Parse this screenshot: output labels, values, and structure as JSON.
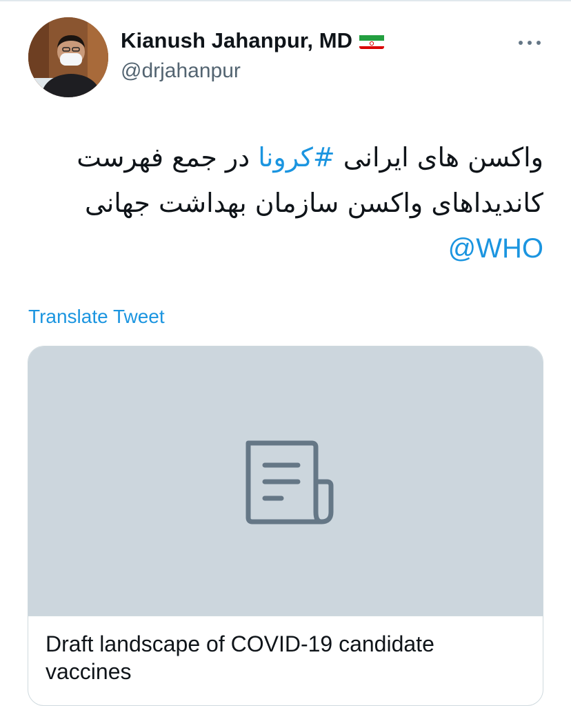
{
  "tweet": {
    "author": {
      "display_name": "Kianush Jahanpur, MD",
      "flag_icon": "iran-flag-icon",
      "handle": "@drjahanpur",
      "avatar_icon": "user-avatar"
    },
    "more_icon": "more-dots-icon",
    "text": {
      "part1": "واکسن های ایرانی ",
      "hashtag": "#کرونا",
      "part2": " در جمع فهرست کاندیداهای واکسن سازمان بهداشت جهانی",
      "mention": "@WHO"
    },
    "translate_label": "Translate Tweet",
    "card": {
      "media_icon": "article-document-icon",
      "title": "Draft landscape of COVID-19 candidate vaccines"
    }
  },
  "colors": {
    "link": "#1b95e0",
    "secondary_text": "#536471",
    "card_media_bg": "#ccd6dd",
    "card_icon": "#657786",
    "border": "#cfd9de"
  }
}
